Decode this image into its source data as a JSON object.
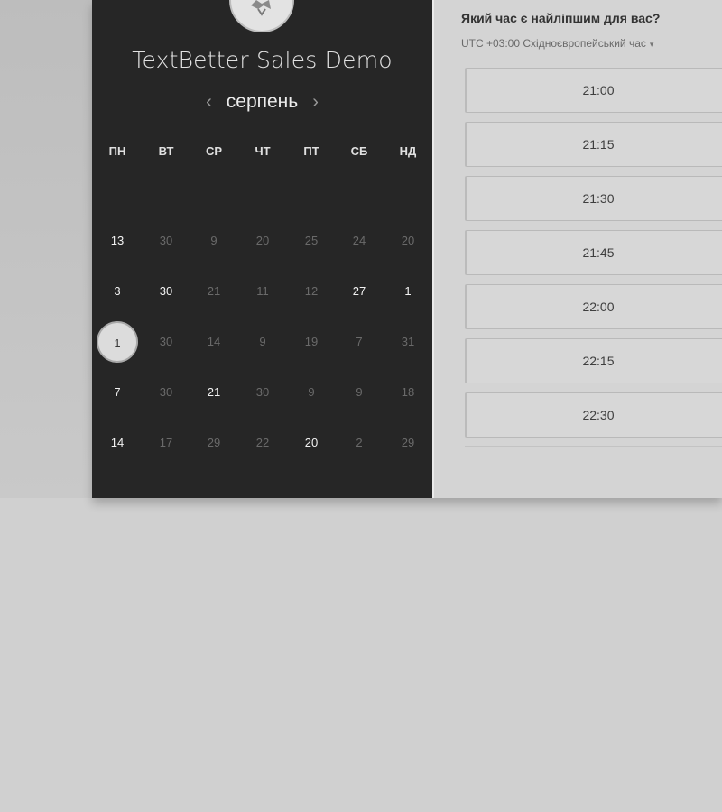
{
  "calendar": {
    "title": "TextBetter Sales Demo",
    "month": "серпень",
    "prev_icon": "‹",
    "next_icon": "›",
    "weekdays": [
      "ПН",
      "ВТ",
      "СР",
      "ЧТ",
      "ПТ",
      "СБ",
      "НД"
    ],
    "weeks": [
      [
        {
          "d": "13",
          "a": true
        },
        {
          "d": "30",
          "a": false
        },
        {
          "d": "9",
          "a": false
        },
        {
          "d": "20",
          "a": false
        },
        {
          "d": "25",
          "a": false
        },
        {
          "d": "24",
          "a": false
        },
        {
          "d": "20",
          "a": false
        }
      ],
      [
        {
          "d": "3",
          "a": true
        },
        {
          "d": "30",
          "a": true
        },
        {
          "d": "21",
          "a": false
        },
        {
          "d": "11",
          "a": false
        },
        {
          "d": "12",
          "a": false
        },
        {
          "d": "27",
          "a": true
        },
        {
          "d": "1",
          "a": true
        }
      ],
      [
        {
          "d": "1",
          "a": true,
          "s": true
        },
        {
          "d": "30",
          "a": false
        },
        {
          "d": "14",
          "a": false
        },
        {
          "d": "9",
          "a": false
        },
        {
          "d": "19",
          "a": false
        },
        {
          "d": "7",
          "a": false
        },
        {
          "d": "31",
          "a": false
        }
      ],
      [
        {
          "d": "7",
          "a": true
        },
        {
          "d": "30",
          "a": false
        },
        {
          "d": "21",
          "a": true
        },
        {
          "d": "30",
          "a": false
        },
        {
          "d": "9",
          "a": false
        },
        {
          "d": "9",
          "a": false
        },
        {
          "d": "18",
          "a": false
        }
      ],
      [
        {
          "d": "14",
          "a": true
        },
        {
          "d": "17",
          "a": false
        },
        {
          "d": "29",
          "a": false
        },
        {
          "d": "22",
          "a": false
        },
        {
          "d": "20",
          "a": true
        },
        {
          "d": "2",
          "a": false
        },
        {
          "d": "29",
          "a": false
        }
      ]
    ]
  },
  "times": {
    "question": "Який час є найліпшим для вас?",
    "timezone": "UTC +03:00 Східноєвропейський час",
    "timezone_caret": "▾",
    "slots": [
      "21:00",
      "21:15",
      "21:30",
      "21:45",
      "22:00",
      "22:15",
      "22:30"
    ]
  },
  "colors": {
    "calendar_bg": "#262626",
    "times_bg": "#d4d4d4",
    "page_bg": "#d0d0d0"
  }
}
